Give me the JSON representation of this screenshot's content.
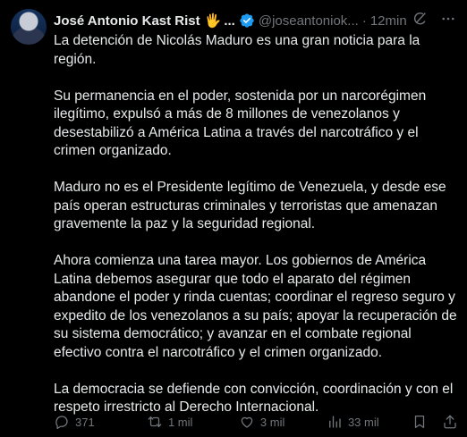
{
  "author": {
    "name": "José Antonio Kast Rist",
    "emoji": "🖐",
    "ellipsis": "...",
    "handle": "@joseantoniok...",
    "dot": "·",
    "time": "12min"
  },
  "body": {
    "paragraphs": [
      "La detención de Nicolás Maduro es una gran noticia para la región.",
      "Su permanencia en el poder, sostenida por un narcorégimen ilegítimo, expulsó a más de 8 millones de venezolanos y desestabilizó a América Latina a través del narcotráfico y el crimen organizado.",
      "Maduro no es el Presidente legítimo de Venezuela, y desde ese país operan estructuras criminales y terroristas que amenazan gravemente la paz y la seguridad regional.",
      "Ahora comienza una tarea mayor. Los gobiernos de América Latina debemos asegurar que todo el aparato del régimen abandone el poder y rinda cuentas; coordinar el regreso seguro y expedito de los venezolanos a su país; apoyar la recuperación de su sistema democrático; y avanzar en el combate regional efectivo contra el narcotráfico y el crimen organizado.",
      "La democracia se defiende con convicción, coordinación y con el respeto irrestricto al Derecho Internacional."
    ]
  },
  "actions": {
    "replies": "371",
    "retweets": "1 mil",
    "likes": "3 mil",
    "views": "33 mil"
  },
  "icons": {
    "verified": "verified-badge-icon",
    "grok": "grok-icon",
    "more": "more-icon",
    "reply": "reply-icon",
    "retweet": "retweet-icon",
    "like": "like-icon",
    "views": "views-icon",
    "bookmark": "bookmark-icon",
    "share": "share-icon"
  },
  "colors": {
    "background": "#000000",
    "text": "#e7e9ea",
    "muted": "#71767b",
    "verified": "#1d9bf0"
  }
}
